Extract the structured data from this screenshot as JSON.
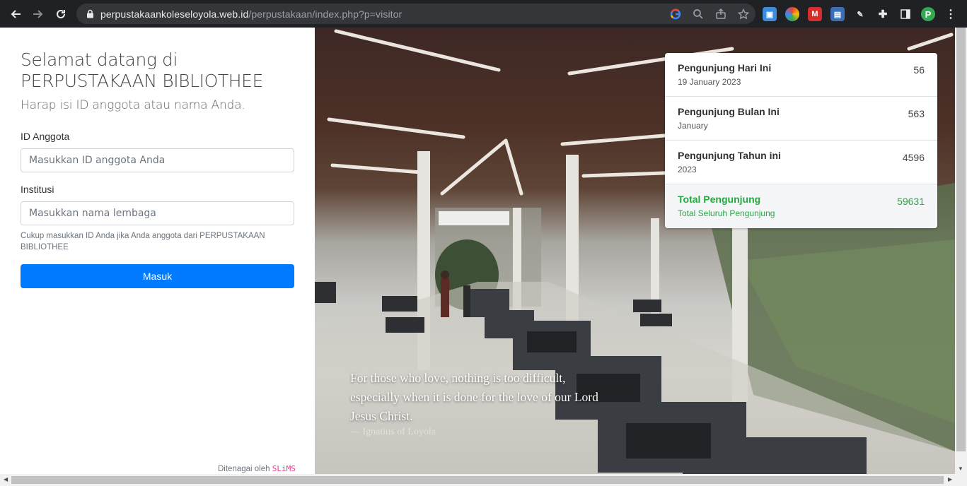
{
  "browser": {
    "url_domain": "perpustakaankoleseloyola.web.id",
    "url_path": "/perpustakaan/index.php?p=visitor",
    "profile_initial": "P"
  },
  "form": {
    "welcome": "Selamat datang di PERPUSTAKAAN BIBLIOTHEE",
    "subtitle": "Harap isi ID anggota atau nama Anda.",
    "member_id_label": "ID Anggota",
    "member_id_placeholder": "Masukkan ID anggota Anda",
    "institution_label": "Institusi",
    "institution_placeholder": "Masukkan nama lembaga",
    "hint": "Cukup masukkan ID Anda jika Anda anggota dari PERPUSTAKAAN BIBLIOTHEE",
    "submit_label": "Masuk",
    "powered_by": "Ditenagai oleh",
    "powered_brand": "SLiMS"
  },
  "stats": {
    "today_title": "Pengunjung Hari Ini",
    "today_date": "19 January 2023",
    "today_count": "56",
    "month_title": "Pengunjung Bulan Ini",
    "month_name": "January",
    "month_count": "563",
    "year_title": "Pengunjung Tahun ini",
    "year_name": "2023",
    "year_count": "4596",
    "total_title": "Total Pengunjung",
    "total_sub": "Total Seluruh Pengunjung",
    "total_count": "59631",
    "total_color": "#28a745"
  },
  "quote": {
    "text": "For those who love, nothing is too difficult, especially when it is done for the love of our Lord Jesus Christ.",
    "author": "— Ignatius of Loyola"
  },
  "colors": {
    "primary": "#007bff",
    "brand": "#e83e8c",
    "chrome_bg": "#202124"
  }
}
